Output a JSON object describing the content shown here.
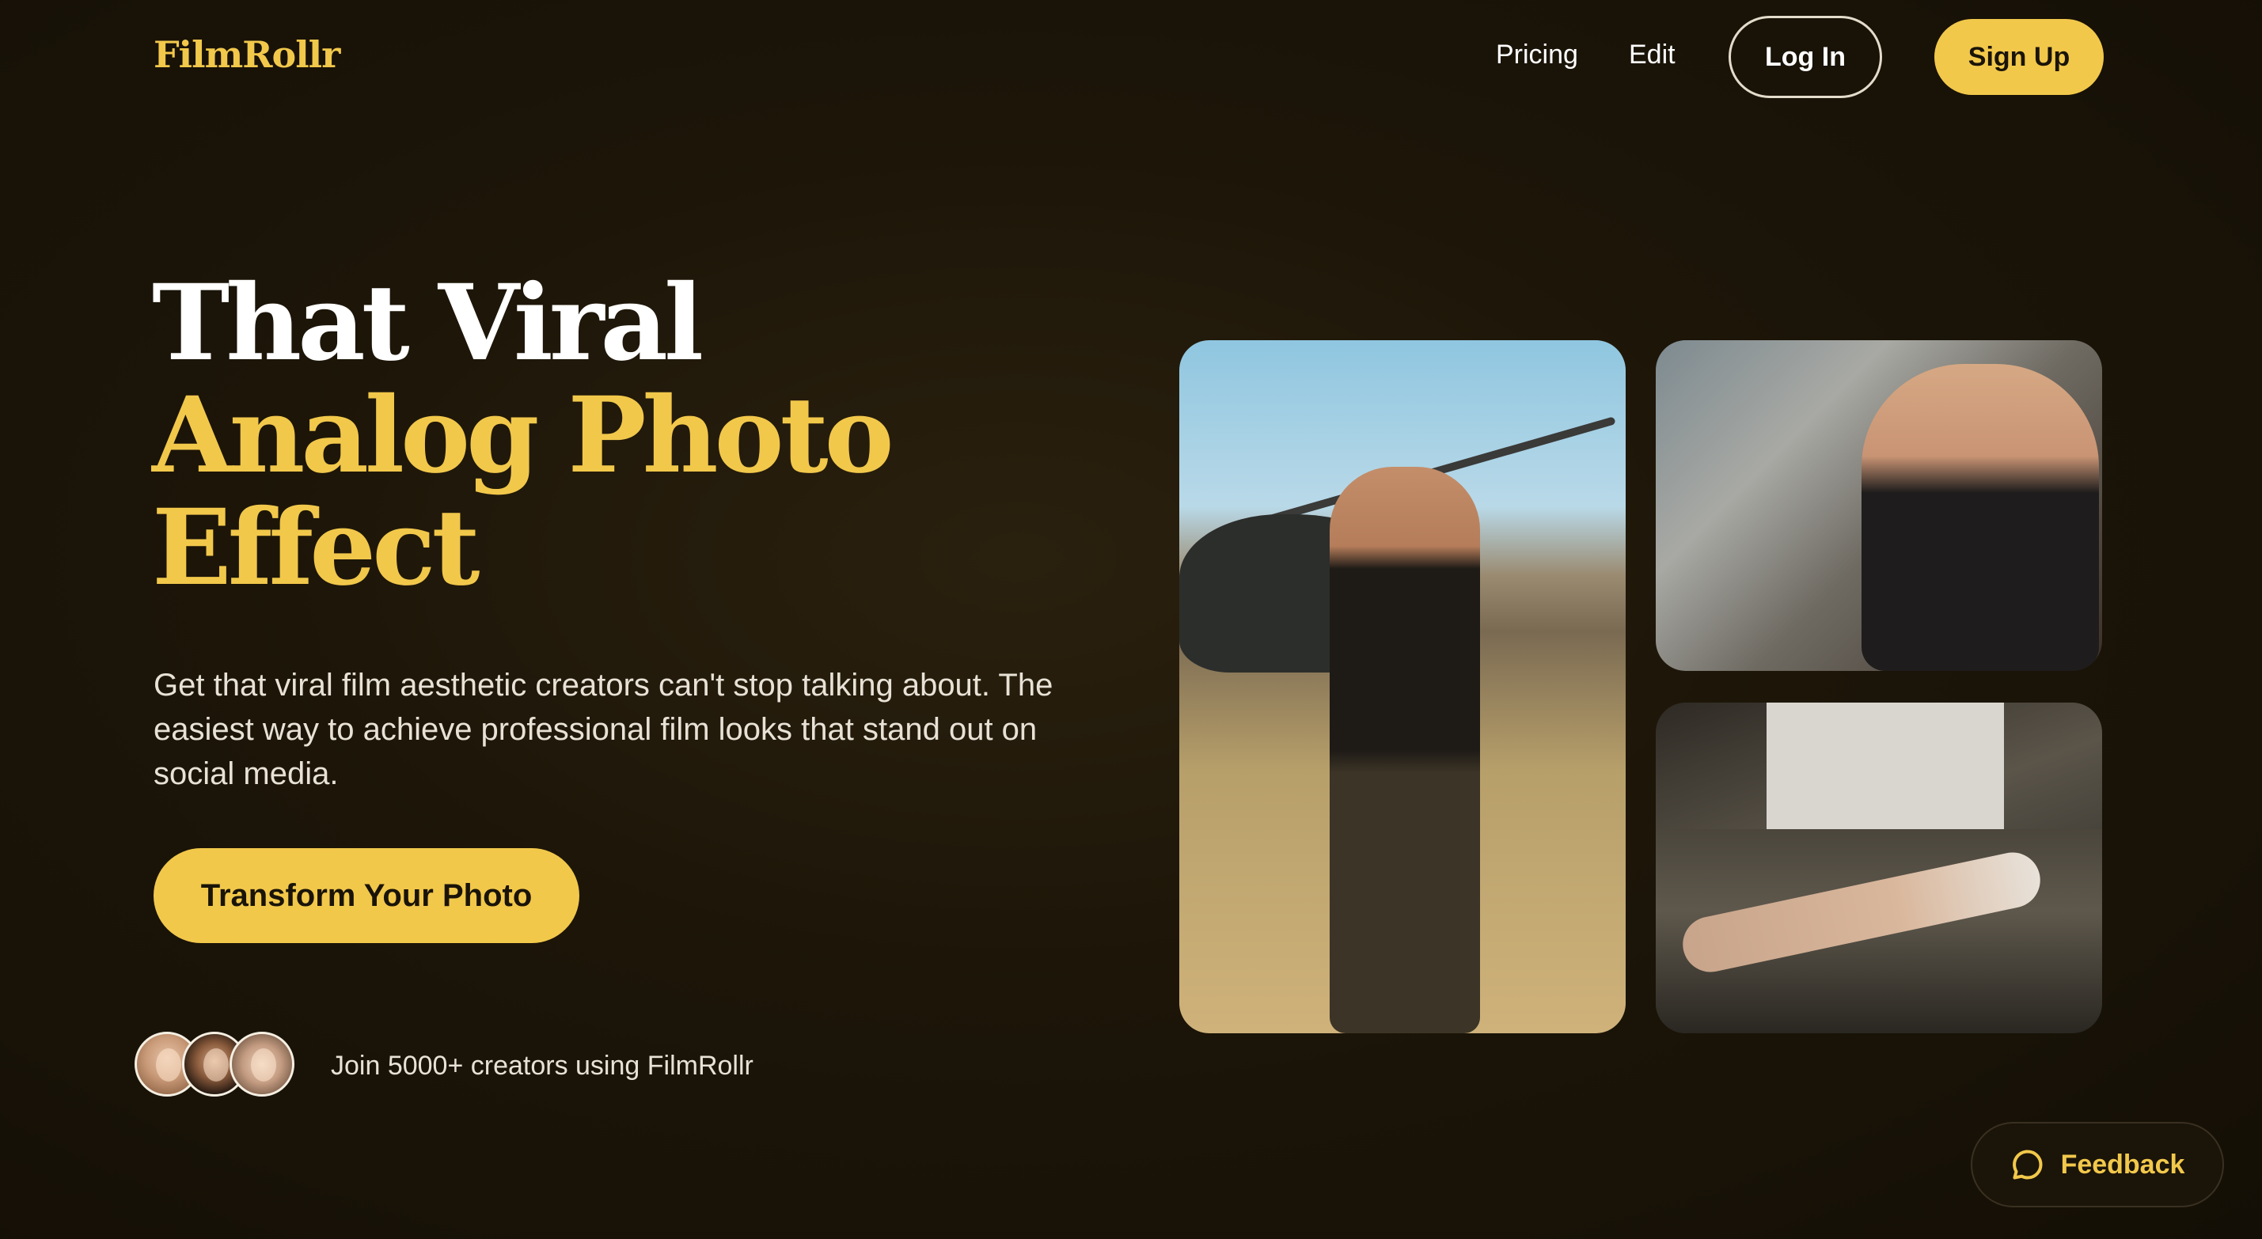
{
  "brand": {
    "logo_text": "FilmRollr",
    "accent_color": "#f2c84b"
  },
  "nav": {
    "links": [
      {
        "label": "Pricing"
      },
      {
        "label": "Edit"
      }
    ],
    "login_label": "Log In",
    "signup_label": "Sign Up"
  },
  "hero": {
    "headline_line1": "That Viral",
    "headline_line2": "Analog Photo",
    "headline_line3": "Effect",
    "subtext": "Get that viral film aesthetic creators can't stop talking about. The easiest way to achieve professional film looks that stand out on social media.",
    "cta_label": "Transform Your Photo"
  },
  "social_proof": {
    "text": "Join 5000+ creators using FilmRollr",
    "avatars": [
      "avatar-1",
      "avatar-2",
      "avatar-3"
    ]
  },
  "gallery": {
    "photos": [
      "photo-helicopter-man",
      "photo-peace-sign-man",
      "photo-woman-on-sofa"
    ]
  },
  "feedback": {
    "label": "Feedback",
    "icon": "chat-bubble-icon"
  }
}
